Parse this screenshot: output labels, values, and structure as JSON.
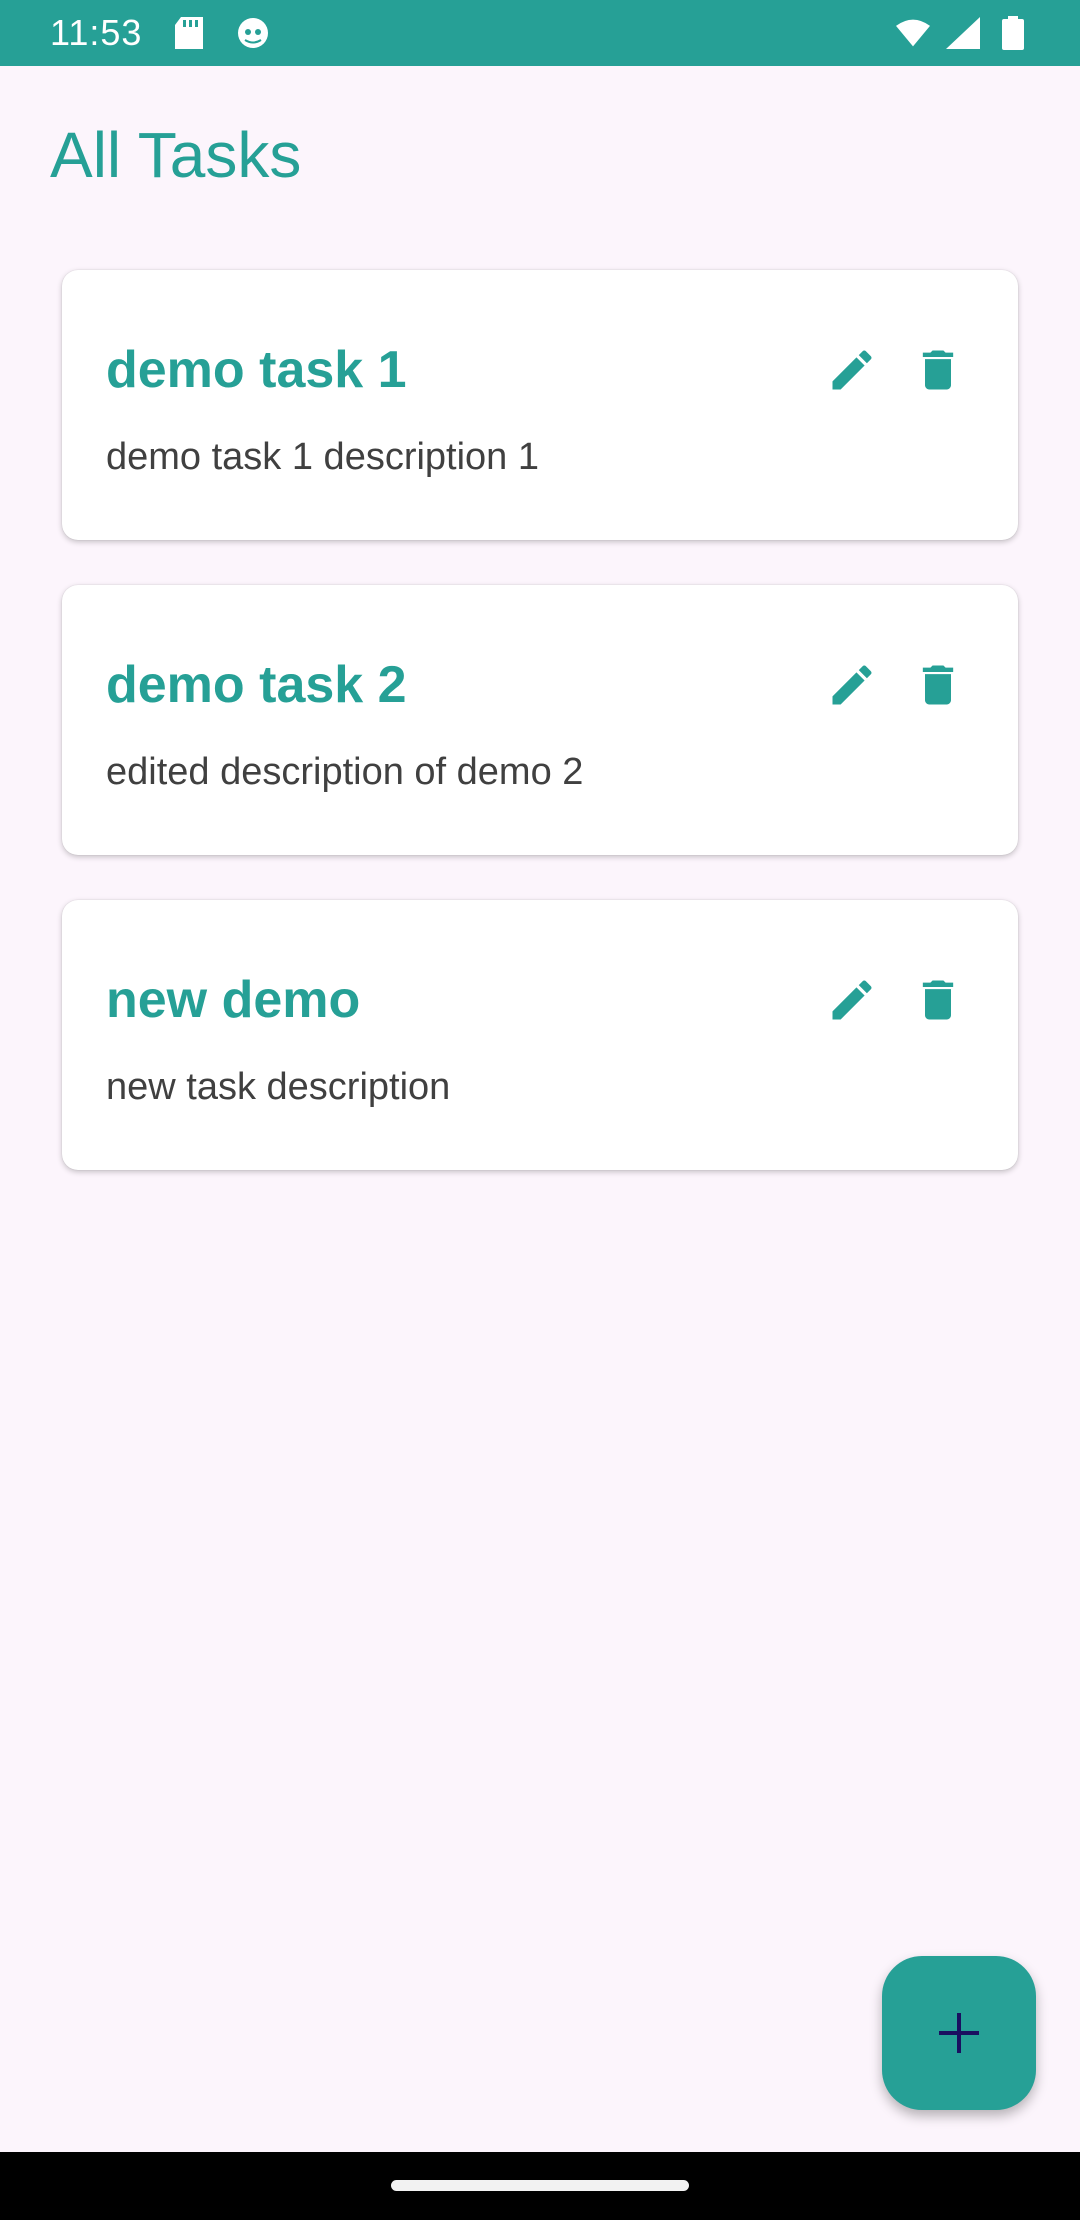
{
  "status_bar": {
    "time": "11:53",
    "icons": [
      "sd-card-icon",
      "android-debug-icon",
      "wifi-icon",
      "signal-icon",
      "battery-icon"
    ]
  },
  "page": {
    "title": "All Tasks"
  },
  "tasks": [
    {
      "title": "demo task 1",
      "description": "demo task 1 description 1"
    },
    {
      "title": "demo task 2",
      "description": "edited description of demo 2"
    },
    {
      "title": "new demo",
      "description": "new task description"
    }
  ],
  "actions": {
    "edit_icon": "pencil-icon",
    "delete_icon": "trash-icon",
    "add_icon": "plus-icon"
  },
  "colors": {
    "accent": "#26a096",
    "background": "#fcf5fc",
    "card": "#ffffff",
    "fab_icon": "#1a1060"
  }
}
